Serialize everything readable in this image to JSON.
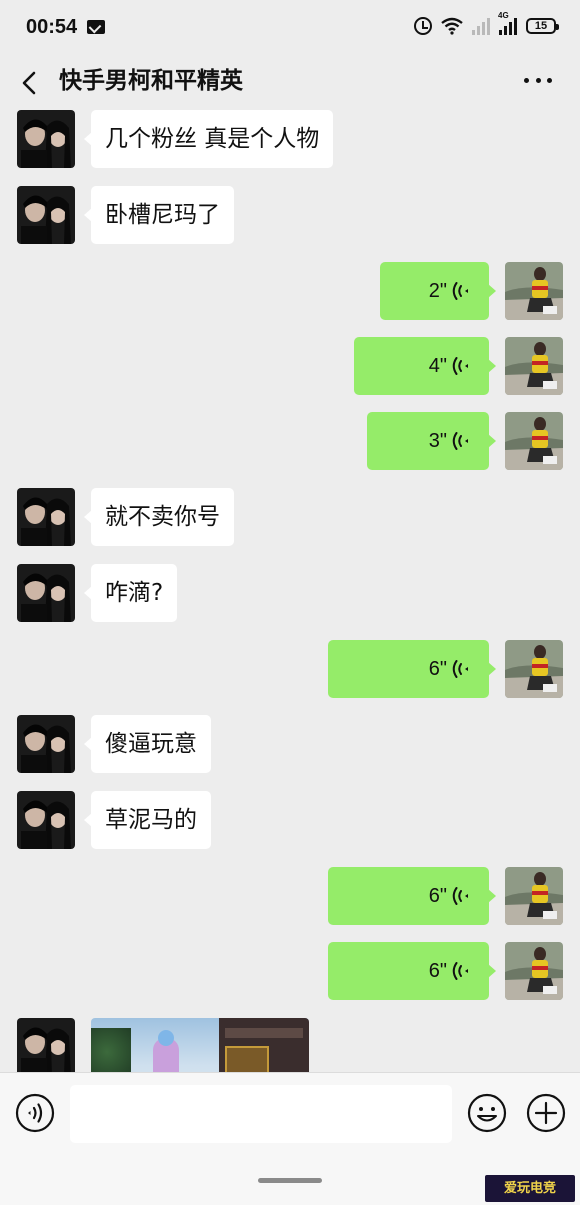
{
  "status_bar": {
    "time": "00:54",
    "network_label": "4G",
    "battery": "15"
  },
  "header": {
    "title": "快手男柯和平精英"
  },
  "messages": [
    {
      "direction": "in",
      "type": "text",
      "text": "几个粉丝 真是个人物"
    },
    {
      "direction": "in",
      "type": "text",
      "text": "卧槽尼玛了"
    },
    {
      "direction": "out",
      "type": "voice",
      "duration": "2\""
    },
    {
      "direction": "out",
      "type": "voice",
      "duration": "4\""
    },
    {
      "direction": "out",
      "type": "voice",
      "duration": "3\""
    },
    {
      "direction": "in",
      "type": "text",
      "text": "就不卖你号"
    },
    {
      "direction": "in",
      "type": "text",
      "text": "咋滴?"
    },
    {
      "direction": "out",
      "type": "voice",
      "duration": "6\""
    },
    {
      "direction": "in",
      "type": "text",
      "text": "傻逼玩意"
    },
    {
      "direction": "in",
      "type": "text",
      "text": "草泥马的"
    },
    {
      "direction": "out",
      "type": "voice",
      "duration": "6\""
    },
    {
      "direction": "out",
      "type": "voice",
      "duration": "6\""
    },
    {
      "direction": "in",
      "type": "image"
    }
  ],
  "input_bar": {
    "placeholder": "",
    "value": ""
  },
  "watermark": {
    "text": "爱玩电竞"
  },
  "colors": {
    "background": "#ededed",
    "outgoing_bubble": "#95ec69",
    "incoming_bubble": "#ffffff"
  }
}
